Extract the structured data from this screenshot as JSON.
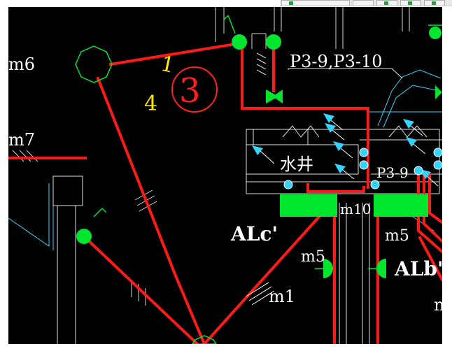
{
  "toolbar": {
    "label": ""
  },
  "labels": {
    "m6": "m6",
    "m7": "m7",
    "sheet_ref": "P3-9,P3-10",
    "water_well": "水井",
    "p39": "P3-9",
    "m10": "m10",
    "m5_left": "m5",
    "m5_right": "m5",
    "alc": "ALc'",
    "alb": "ALb'",
    "m1": "m1",
    "m_edge": "m"
  },
  "annotation": {
    "fraction_numerator": "1",
    "fraction_denominator": "4",
    "circled_number": "3"
  },
  "colors": {
    "background": "#000000",
    "wire": "#ff1a1a",
    "node": "#00e52e",
    "outline": "#33d4ff",
    "text": "#ffffff",
    "handwriting_yellow": "#ffe600",
    "handwriting_red": "#ff2020"
  }
}
